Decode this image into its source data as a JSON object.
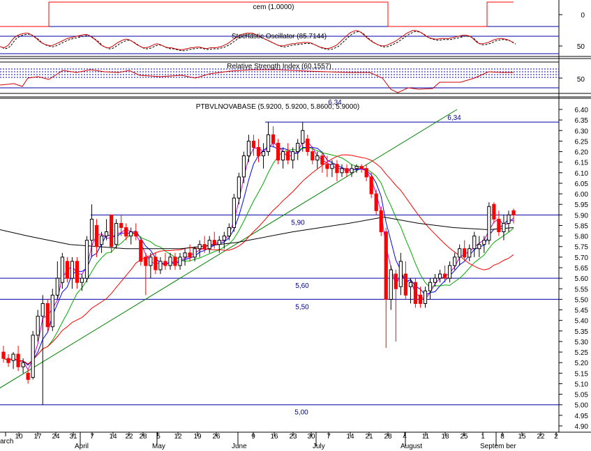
{
  "chart_data": {
    "type": "candlestick",
    "panels": {
      "cem": {
        "title": "cem (1.0000)",
        "y_ticks": [
          "0"
        ]
      },
      "stochastic": {
        "title": "Stochastic Oscillator (85.7144)",
        "y_ticks": [
          "50"
        ]
      },
      "rsi": {
        "title": "Relative Strength Index (60.1557)",
        "y_ticks": [
          "50"
        ],
        "overlay_label": "6,34"
      },
      "price": {
        "title": "PTBVLNOVABASE (5.9200, 5.9200, 5.8600, 5.9000)",
        "ylim": [
          4.9,
          6.4
        ],
        "y_ticks": [
          "6.40",
          "6.35",
          "6.30",
          "6.25",
          "6.20",
          "6.15",
          "6.10",
          "6.05",
          "6.00",
          "5.95",
          "5.90",
          "5.85",
          "5.80",
          "5.75",
          "5.70",
          "5.65",
          "5.60",
          "5.55",
          "5.50",
          "5.45",
          "5.40",
          "5.35",
          "5.30",
          "5.25",
          "5.20",
          "5.15",
          "5.10",
          "5.05",
          "5.00",
          "4.95",
          "4.90"
        ],
        "levels": [
          {
            "value": 6.34,
            "label": "6,34"
          },
          {
            "value": 5.9,
            "label": "5,90"
          },
          {
            "value": 5.6,
            "label": "5,60"
          },
          {
            "value": 5.5,
            "label": "5,50"
          },
          {
            "value": 5.0,
            "label": "5,00"
          }
        ]
      }
    },
    "x_ticks": [
      "arch",
      "10",
      "17",
      "24",
      "31",
      "April",
      "7",
      "14",
      "22",
      "28",
      "May",
      "5",
      "12",
      "19",
      "26",
      "June",
      "9",
      "16",
      "23",
      "30",
      "July",
      "7",
      "14",
      "21",
      "28",
      "August",
      "4",
      "11",
      "18",
      "25",
      "1",
      "Septem ber",
      "8",
      "15",
      "22",
      "2"
    ],
    "candles": [
      {
        "o": 5.25,
        "h": 5.28,
        "l": 5.2,
        "c": 5.22,
        "u": false
      },
      {
        "o": 5.22,
        "h": 5.24,
        "l": 5.18,
        "c": 5.2,
        "u": false
      },
      {
        "o": 5.21,
        "h": 5.25,
        "l": 5.17,
        "c": 5.24,
        "u": true
      },
      {
        "o": 5.24,
        "h": 5.28,
        "l": 5.16,
        "c": 5.18,
        "u": false
      },
      {
        "o": 5.18,
        "h": 5.22,
        "l": 5.15,
        "c": 5.2,
        "u": true
      },
      {
        "o": 5.15,
        "h": 5.17,
        "l": 5.1,
        "c": 5.12,
        "u": false
      },
      {
        "o": 5.13,
        "h": 5.35,
        "l": 5.12,
        "c": 5.33,
        "u": true
      },
      {
        "o": 5.33,
        "h": 5.45,
        "l": 5.3,
        "c": 5.42,
        "u": true
      },
      {
        "o": 5.42,
        "h": 5.52,
        "l": 5.0,
        "c": 5.48,
        "u": true
      },
      {
        "o": 5.48,
        "h": 5.5,
        "l": 5.35,
        "c": 5.37,
        "u": false
      },
      {
        "o": 5.37,
        "h": 5.55,
        "l": 5.35,
        "c": 5.52,
        "u": true
      },
      {
        "o": 5.52,
        "h": 5.68,
        "l": 5.5,
        "c": 5.6,
        "u": true
      },
      {
        "o": 5.58,
        "h": 5.72,
        "l": 5.55,
        "c": 5.7,
        "u": true
      },
      {
        "o": 5.68,
        "h": 5.7,
        "l": 5.58,
        "c": 5.6,
        "u": false
      },
      {
        "o": 5.6,
        "h": 5.7,
        "l": 5.55,
        "c": 5.68,
        "u": true
      },
      {
        "o": 5.68,
        "h": 5.7,
        "l": 5.55,
        "c": 5.58,
        "u": false
      },
      {
        "o": 5.58,
        "h": 5.62,
        "l": 5.54,
        "c": 5.6,
        "u": true
      },
      {
        "o": 5.6,
        "h": 5.8,
        "l": 5.58,
        "c": 5.78,
        "u": true
      },
      {
        "o": 5.78,
        "h": 5.95,
        "l": 5.7,
        "c": 5.88,
        "u": true
      },
      {
        "o": 5.85,
        "h": 5.88,
        "l": 5.7,
        "c": 5.75,
        "u": false
      },
      {
        "o": 5.76,
        "h": 5.82,
        "l": 5.72,
        "c": 5.8,
        "u": true
      },
      {
        "o": 5.8,
        "h": 5.88,
        "l": 5.78,
        "c": 5.82,
        "u": true
      },
      {
        "o": 5.9,
        "h": 5.9,
        "l": 5.72,
        "c": 5.75,
        "u": false
      },
      {
        "o": 5.76,
        "h": 5.88,
        "l": 5.74,
        "c": 5.86,
        "u": true
      },
      {
        "o": 5.86,
        "h": 5.9,
        "l": 5.8,
        "c": 5.84,
        "u": false
      },
      {
        "o": 5.84,
        "h": 5.86,
        "l": 5.78,
        "c": 5.8,
        "u": false
      },
      {
        "o": 5.8,
        "h": 5.84,
        "l": 5.76,
        "c": 5.82,
        "u": true
      },
      {
        "o": 5.82,
        "h": 5.86,
        "l": 5.78,
        "c": 5.8,
        "u": false
      },
      {
        "o": 5.78,
        "h": 5.8,
        "l": 5.66,
        "c": 5.68,
        "u": false
      },
      {
        "o": 5.7,
        "h": 5.72,
        "l": 5.52,
        "c": 5.66,
        "u": false
      },
      {
        "o": 5.66,
        "h": 5.72,
        "l": 5.6,
        "c": 5.7,
        "u": true
      },
      {
        "o": 5.7,
        "h": 5.72,
        "l": 5.62,
        "c": 5.64,
        "u": false
      },
      {
        "o": 5.64,
        "h": 5.7,
        "l": 5.62,
        "c": 5.68,
        "u": true
      },
      {
        "o": 5.68,
        "h": 5.72,
        "l": 5.64,
        "c": 5.66,
        "u": false
      },
      {
        "o": 5.66,
        "h": 5.72,
        "l": 5.64,
        "c": 5.7,
        "u": true
      },
      {
        "o": 5.7,
        "h": 5.72,
        "l": 5.64,
        "c": 5.66,
        "u": false
      },
      {
        "o": 5.66,
        "h": 5.72,
        "l": 5.64,
        "c": 5.7,
        "u": true
      },
      {
        "o": 5.7,
        "h": 5.74,
        "l": 5.66,
        "c": 5.72,
        "u": true
      },
      {
        "o": 5.72,
        "h": 5.76,
        "l": 5.68,
        "c": 5.7,
        "u": false
      },
      {
        "o": 5.7,
        "h": 5.75,
        "l": 5.68,
        "c": 5.74,
        "u": true
      },
      {
        "o": 5.74,
        "h": 5.78,
        "l": 5.7,
        "c": 5.76,
        "u": true
      },
      {
        "o": 5.76,
        "h": 5.8,
        "l": 5.72,
        "c": 5.74,
        "u": false
      },
      {
        "o": 5.74,
        "h": 5.8,
        "l": 5.72,
        "c": 5.78,
        "u": true
      },
      {
        "o": 5.78,
        "h": 5.82,
        "l": 5.74,
        "c": 5.76,
        "u": false
      },
      {
        "o": 5.76,
        "h": 5.8,
        "l": 5.72,
        "c": 5.78,
        "u": true
      },
      {
        "o": 5.78,
        "h": 5.82,
        "l": 5.74,
        "c": 5.8,
        "u": true
      },
      {
        "o": 5.8,
        "h": 5.86,
        "l": 5.78,
        "c": 5.84,
        "u": true
      },
      {
        "o": 5.84,
        "h": 6.0,
        "l": 5.82,
        "c": 5.98,
        "u": true
      },
      {
        "o": 5.98,
        "h": 6.1,
        "l": 5.95,
        "c": 6.08,
        "u": true
      },
      {
        "o": 6.08,
        "h": 6.2,
        "l": 6.05,
        "c": 6.18,
        "u": true
      },
      {
        "o": 6.18,
        "h": 6.28,
        "l": 6.15,
        "c": 6.25,
        "u": true
      },
      {
        "o": 6.25,
        "h": 6.28,
        "l": 6.18,
        "c": 6.22,
        "u": false
      },
      {
        "o": 6.22,
        "h": 6.26,
        "l": 6.15,
        "c": 6.18,
        "u": false
      },
      {
        "o": 6.18,
        "h": 6.24,
        "l": 6.12,
        "c": 6.2,
        "u": true
      },
      {
        "o": 6.2,
        "h": 6.34,
        "l": 6.18,
        "c": 6.28,
        "u": true
      },
      {
        "o": 6.28,
        "h": 6.32,
        "l": 6.22,
        "c": 6.24,
        "u": false
      },
      {
        "o": 6.24,
        "h": 6.26,
        "l": 6.14,
        "c": 6.16,
        "u": false
      },
      {
        "o": 6.16,
        "h": 6.22,
        "l": 6.12,
        "c": 6.2,
        "u": true
      },
      {
        "o": 6.2,
        "h": 6.24,
        "l": 6.14,
        "c": 6.16,
        "u": false
      },
      {
        "o": 6.16,
        "h": 6.22,
        "l": 6.12,
        "c": 6.2,
        "u": true
      },
      {
        "o": 6.2,
        "h": 6.26,
        "l": 6.16,
        "c": 6.24,
        "u": true
      },
      {
        "o": 6.24,
        "h": 6.34,
        "l": 6.2,
        "c": 6.3,
        "u": true
      },
      {
        "o": 6.26,
        "h": 6.28,
        "l": 6.18,
        "c": 6.2,
        "u": false
      },
      {
        "o": 6.2,
        "h": 6.22,
        "l": 6.14,
        "c": 6.16,
        "u": false
      },
      {
        "o": 6.16,
        "h": 6.2,
        "l": 6.12,
        "c": 6.18,
        "u": true
      },
      {
        "o": 6.18,
        "h": 6.2,
        "l": 6.1,
        "c": 6.14,
        "u": false
      },
      {
        "o": 6.14,
        "h": 6.18,
        "l": 6.08,
        "c": 6.12,
        "u": false
      },
      {
        "o": 6.12,
        "h": 6.16,
        "l": 6.08,
        "c": 6.14,
        "u": true
      },
      {
        "o": 6.14,
        "h": 6.16,
        "l": 6.06,
        "c": 6.1,
        "u": false
      },
      {
        "o": 6.1,
        "h": 6.14,
        "l": 6.08,
        "c": 6.12,
        "u": true
      },
      {
        "o": 6.12,
        "h": 6.14,
        "l": 6.08,
        "c": 6.1,
        "u": false
      },
      {
        "o": 6.1,
        "h": 6.14,
        "l": 6.08,
        "c": 6.12,
        "u": true
      },
      {
        "o": 6.12,
        "h": 6.14,
        "l": 6.1,
        "c": 6.13,
        "u": true
      },
      {
        "o": 6.13,
        "h": 6.14,
        "l": 6.1,
        "c": 6.12,
        "u": false
      },
      {
        "o": 6.12,
        "h": 6.14,
        "l": 6.06,
        "c": 6.08,
        "u": false
      },
      {
        "o": 6.08,
        "h": 6.1,
        "l": 5.98,
        "c": 6.0,
        "u": false
      },
      {
        "o": 6.0,
        "h": 6.02,
        "l": 5.9,
        "c": 5.92,
        "u": false
      },
      {
        "o": 5.92,
        "h": 5.94,
        "l": 5.8,
        "c": 5.82,
        "u": false
      },
      {
        "o": 5.82,
        "h": 5.84,
        "l": 5.27,
        "c": 5.5,
        "u": false
      },
      {
        "o": 5.5,
        "h": 5.66,
        "l": 5.45,
        "c": 5.64,
        "u": true
      },
      {
        "o": 5.62,
        "h": 5.64,
        "l": 5.3,
        "c": 5.55,
        "u": false
      },
      {
        "o": 5.56,
        "h": 5.72,
        "l": 5.52,
        "c": 5.68,
        "u": true
      },
      {
        "o": 5.62,
        "h": 5.68,
        "l": 5.5,
        "c": 5.52,
        "u": false
      },
      {
        "o": 5.56,
        "h": 5.6,
        "l": 5.48,
        "c": 5.58,
        "u": true
      },
      {
        "o": 5.58,
        "h": 5.6,
        "l": 5.46,
        "c": 5.48,
        "u": false
      },
      {
        "o": 5.52,
        "h": 5.56,
        "l": 5.46,
        "c": 5.48,
        "u": false
      },
      {
        "o": 5.48,
        "h": 5.56,
        "l": 5.46,
        "c": 5.54,
        "u": true
      },
      {
        "o": 5.54,
        "h": 5.6,
        "l": 5.5,
        "c": 5.58,
        "u": true
      },
      {
        "o": 5.58,
        "h": 5.62,
        "l": 5.56,
        "c": 5.6,
        "u": true
      },
      {
        "o": 5.6,
        "h": 5.64,
        "l": 5.58,
        "c": 5.62,
        "u": true
      },
      {
        "o": 5.62,
        "h": 5.66,
        "l": 5.58,
        "c": 5.6,
        "u": false
      },
      {
        "o": 5.6,
        "h": 5.68,
        "l": 5.58,
        "c": 5.66,
        "u": true
      },
      {
        "o": 5.66,
        "h": 5.72,
        "l": 5.64,
        "c": 5.7,
        "u": true
      },
      {
        "o": 5.7,
        "h": 5.76,
        "l": 5.66,
        "c": 5.74,
        "u": true
      },
      {
        "o": 5.74,
        "h": 5.78,
        "l": 5.68,
        "c": 5.7,
        "u": false
      },
      {
        "o": 5.7,
        "h": 5.76,
        "l": 5.68,
        "c": 5.74,
        "u": true
      },
      {
        "o": 5.74,
        "h": 5.82,
        "l": 5.7,
        "c": 5.8,
        "u": true
      },
      {
        "o": 5.74,
        "h": 5.8,
        "l": 5.7,
        "c": 5.76,
        "u": true
      },
      {
        "o": 5.76,
        "h": 5.8,
        "l": 5.72,
        "c": 5.78,
        "u": true
      },
      {
        "o": 5.78,
        "h": 5.96,
        "l": 5.76,
        "c": 5.94,
        "u": true
      },
      {
        "o": 5.95,
        "h": 5.96,
        "l": 5.86,
        "c": 5.88,
        "u": false
      },
      {
        "o": 5.88,
        "h": 5.92,
        "l": 5.8,
        "c": 5.82,
        "u": false
      },
      {
        "o": 5.82,
        "h": 5.9,
        "l": 5.78,
        "c": 5.86,
        "u": true
      },
      {
        "o": 5.86,
        "h": 5.92,
        "l": 5.82,
        "c": 5.9,
        "u": true
      },
      {
        "o": 5.92,
        "h": 5.93,
        "l": 5.86,
        "c": 5.9,
        "u": false
      }
    ],
    "colors": {
      "up": "#000000",
      "down": "#ff0000",
      "level_lines": "#0000aa",
      "trendline": "#008000",
      "ma_fast": "#0000ff",
      "ma_mid": "#cc00cc",
      "ma_slow": "#00aa00",
      "ma_long": "#ff0000",
      "ma_longest": "#000000",
      "osc_line": "#cc0000"
    }
  }
}
